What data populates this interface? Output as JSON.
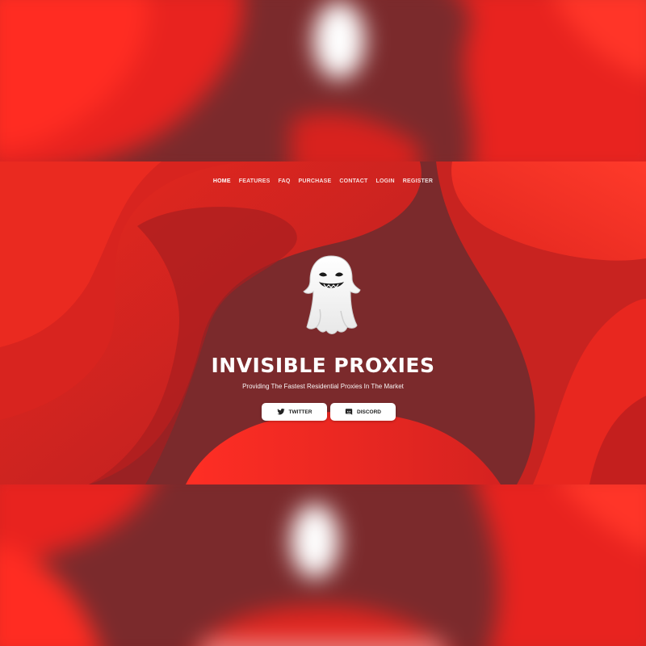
{
  "nav": {
    "items": [
      {
        "label": "HOME",
        "active": true
      },
      {
        "label": "FEATURES",
        "active": false
      },
      {
        "label": "FAQ",
        "active": false
      },
      {
        "label": "PURCHASE",
        "active": false
      },
      {
        "label": "CONTACT",
        "active": false
      },
      {
        "label": "LOGIN",
        "active": false
      },
      {
        "label": "REGISTER",
        "active": false
      }
    ]
  },
  "hero": {
    "title": "INVISIBLE PROXIES",
    "subtitle": "Providing The Fastest Residential Proxies In The Market",
    "logo_icon": "ghost-icon"
  },
  "buttons": {
    "twitter": {
      "label": "TWITTER",
      "icon": "twitter-icon"
    },
    "discord": {
      "label": "DISCORD",
      "icon": "discord-icon"
    }
  },
  "colors": {
    "primary_red": "#f0281f",
    "dark_red": "#7b2a2c",
    "button_bg": "#ffffff",
    "text": "#ffffff"
  }
}
